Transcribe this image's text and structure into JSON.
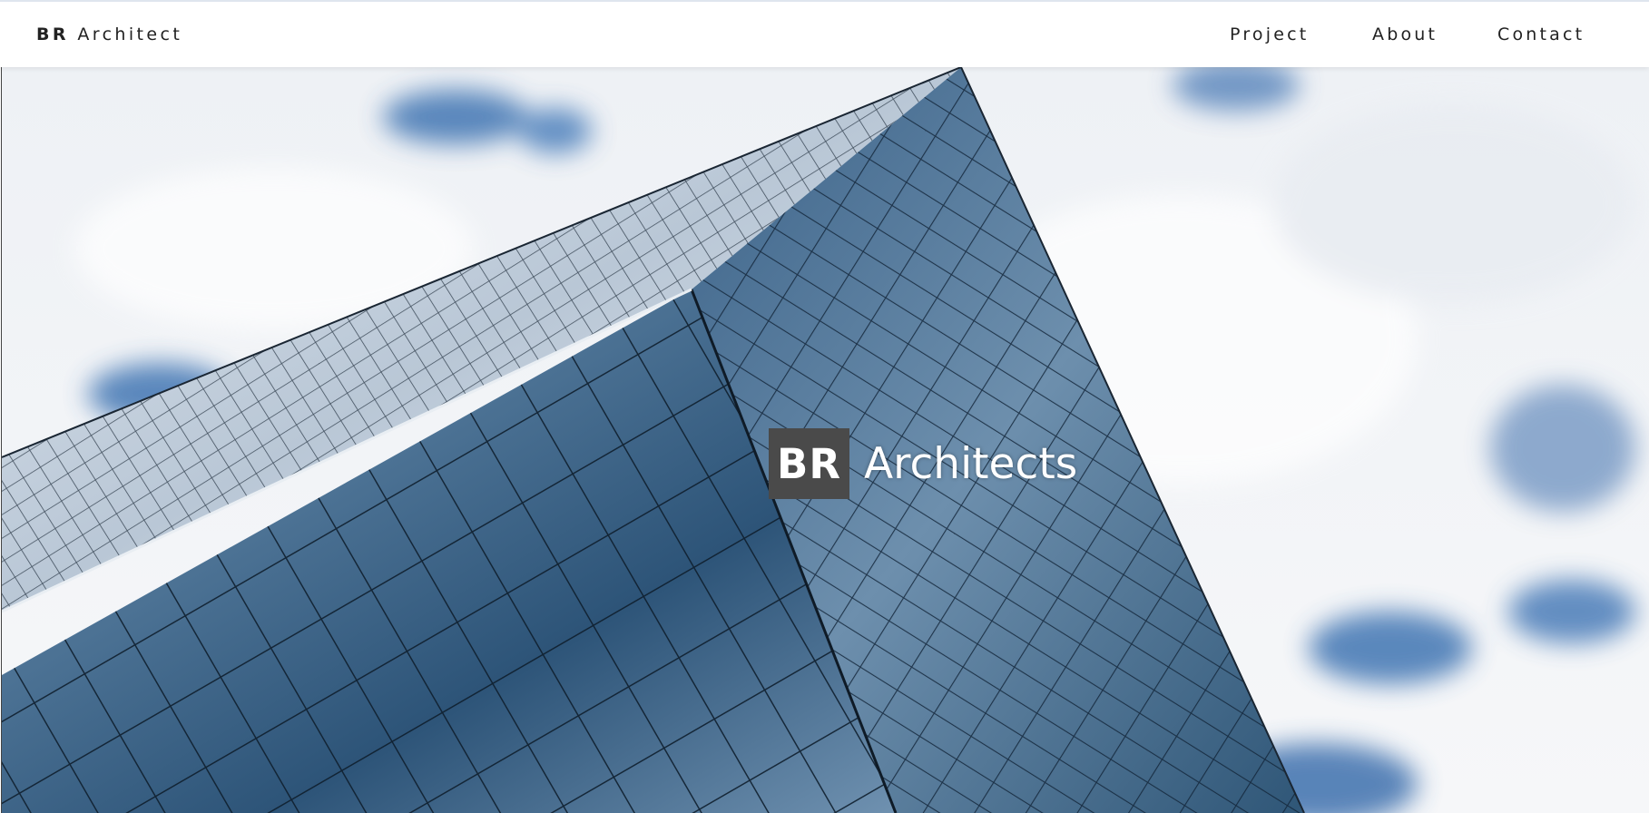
{
  "header": {
    "brand_bold": "BR",
    "brand_rest": "Architect",
    "nav": [
      "Project",
      "About",
      "Contact"
    ]
  },
  "hero": {
    "logo_mark": "BR",
    "logo_name": "Architects",
    "image_subject": "glass skyscraper against cloudy sky"
  },
  "colors": {
    "sky": "#f2f4f7",
    "sky_blue": "#3f74b2",
    "glass_dark": "#2a4a6b",
    "glass_light": "#c9d7e4",
    "logo_box": "#4a4a4a"
  }
}
